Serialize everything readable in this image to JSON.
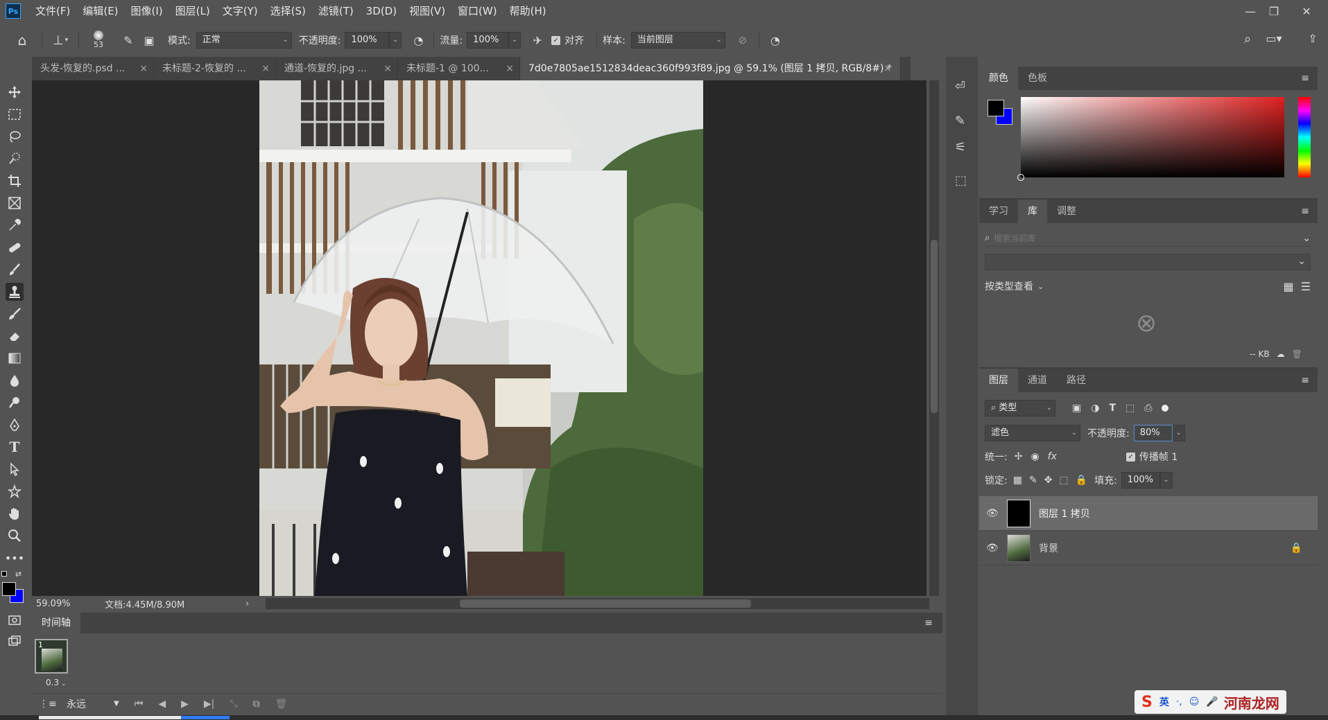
{
  "app": {
    "logo": "Ps"
  },
  "menu": [
    "文件(F)",
    "编辑(E)",
    "图像(I)",
    "图层(L)",
    "文字(Y)",
    "选择(S)",
    "滤镜(T)",
    "3D(D)",
    "视图(V)",
    "窗口(W)",
    "帮助(H)"
  ],
  "options": {
    "brush_size": "53",
    "mode_label": "模式:",
    "mode_value": "正常",
    "opacity_label": "不透明度:",
    "opacity_value": "100%",
    "flow_label": "流量:",
    "flow_value": "100%",
    "align_label": "对齐",
    "sample_label": "样本:",
    "sample_value": "当前图层"
  },
  "tabs": [
    {
      "label": "头发-恢复的.psd ..."
    },
    {
      "label": "未标题-2-恢复的 ..."
    },
    {
      "label": "通道-恢复的.jpg ..."
    },
    {
      "label": "未标题-1 @ 100..."
    },
    {
      "label": "7d0e7805ae1512834deac360f993f89.jpg  @ 59.1% (图层 1 拷贝, RGB/8#) *"
    }
  ],
  "status": {
    "zoom": "59.09%",
    "doc": "文档:4.45M/8.90M"
  },
  "timeline": {
    "title": "时间轴",
    "frame_number": "1",
    "frame_delay": "0.3",
    "loop": "永远"
  },
  "color_panel": {
    "tabs": [
      "颜色",
      "色板"
    ],
    "accent": "#e02020"
  },
  "library_panel": {
    "tabs": [
      "学习",
      "库",
      "调整"
    ],
    "search_placeholder": "搜索当前库",
    "view_by": "按类型查看",
    "size": "-- KB"
  },
  "layers_panel": {
    "tabs": [
      "图层",
      "通道",
      "路径"
    ],
    "filter_kind": "类型",
    "blend_mode": "滤色",
    "opacity_label": "不透明度:",
    "opacity_value": "80%",
    "unify_label": "统一:",
    "propagate_label": "传播帧 1",
    "lock_label": "锁定:",
    "fill_label": "填充:",
    "fill_value": "100%",
    "layers": [
      {
        "name": "图层 1 拷贝",
        "selected": true
      },
      {
        "name": "背景",
        "locked": true
      }
    ]
  },
  "taskbar": {
    "ime": "英",
    "watermark": "河南龙网"
  }
}
